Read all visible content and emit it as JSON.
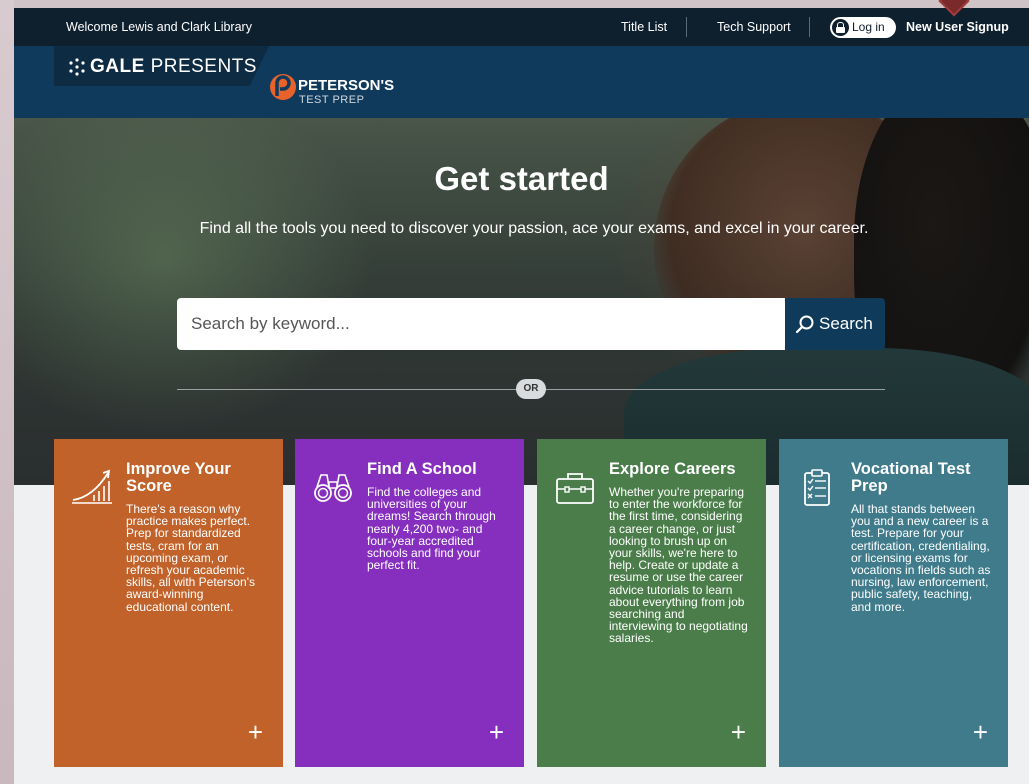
{
  "topbar": {
    "welcome": "Welcome Lewis and Clark Library",
    "title_list": "Title List",
    "tech_support": "Tech Support",
    "login": "Log in",
    "signup": "New User Signup"
  },
  "brand": {
    "gale": "GALE",
    "presents": "PRESENTS",
    "peterson": "PETERSON'S",
    "peterson_sub": "TEST PREP"
  },
  "hero": {
    "title": "Get started",
    "subtitle": "Find all the tools you need to discover your passion, ace your exams, and excel in your career.",
    "search_placeholder": "Search by keyword...",
    "search_button": "Search",
    "or": "OR"
  },
  "cards": [
    {
      "title": "Improve Your Score",
      "desc": "There's a reason why practice makes perfect. Prep for standardized tests, cram for an upcoming exam, or refresh your academic skills, all with Peterson's award-winning educational content.",
      "plus": "+",
      "color": "#c0622a",
      "icon": "chart-growth-icon"
    },
    {
      "title": "Find A School",
      "desc": "Find the colleges and universities of your dreams! Search through nearly 4,200 two- and four-year accredited schools and find your perfect fit.",
      "plus": "+",
      "color": "#862fbe",
      "icon": "binoculars-icon"
    },
    {
      "title": "Explore Careers",
      "desc": "Whether you're preparing to enter the workforce for the first time, considering a career change, or just looking to brush up on your skills, we're here to help. Create or update a resume or use the career advice tutorials to learn about everything from job searching and interviewing to negotiating salaries.",
      "plus": "+",
      "color": "#4b7d4a",
      "icon": "briefcase-icon"
    },
    {
      "title": "Vocational Test Prep",
      "desc": "All that stands between you and a new career is a test. Prepare for your certification, credentialing, or licensing exams for vocations in fields such as nursing, law enforcement, public safety, teaching, and more.",
      "plus": "+",
      "color": "#3f7b8b",
      "icon": "clipboard-checklist-icon"
    }
  ]
}
